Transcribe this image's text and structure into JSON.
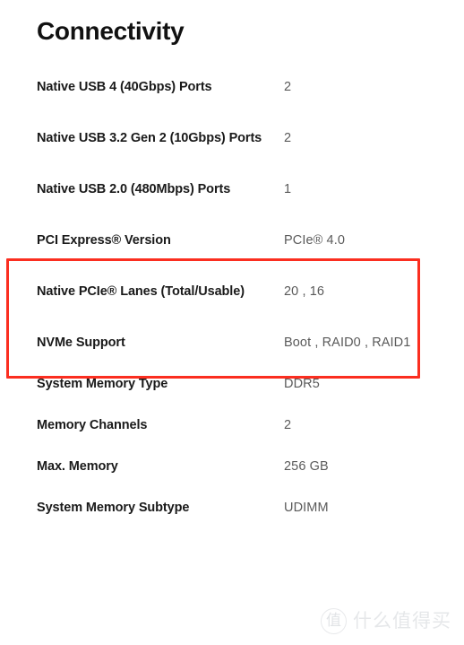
{
  "section": {
    "title": "Connectivity"
  },
  "specs": [
    {
      "label": "Native USB 4 (40Gbps) Ports",
      "value": "2",
      "wrap": false
    },
    {
      "label": "Native USB 3.2 Gen 2 (10Gbps) Ports",
      "value": "2",
      "wrap": true
    },
    {
      "label": "Native USB 2.0 (480Mbps) Ports",
      "value": "1",
      "wrap": true
    },
    {
      "label": "PCI Express® Version",
      "value": "PCIe® 4.0",
      "wrap": false
    },
    {
      "label": "Native PCIe® Lanes (Total/Usable)",
      "value": "20 , 16",
      "wrap": true
    },
    {
      "label": "NVMe Support",
      "value": "Boot , RAID0 , RAID1",
      "wrap": false
    },
    {
      "label": "System Memory Type",
      "value": "DDR5",
      "wrap": false
    },
    {
      "label": "Memory Channels",
      "value": "2",
      "wrap": false
    },
    {
      "label": "Max. Memory",
      "value": "256 GB",
      "wrap": false
    },
    {
      "label": "System Memory Subtype",
      "value": "UDIMM",
      "wrap": false
    }
  ],
  "annotation": {
    "highlight_color": "#fb2e20",
    "covers": [
      "PCI Express® Version",
      "Native PCIe® Lanes (Total/Usable)"
    ]
  },
  "watermark": {
    "logo_glyph": "值",
    "text": "什么值得买"
  }
}
